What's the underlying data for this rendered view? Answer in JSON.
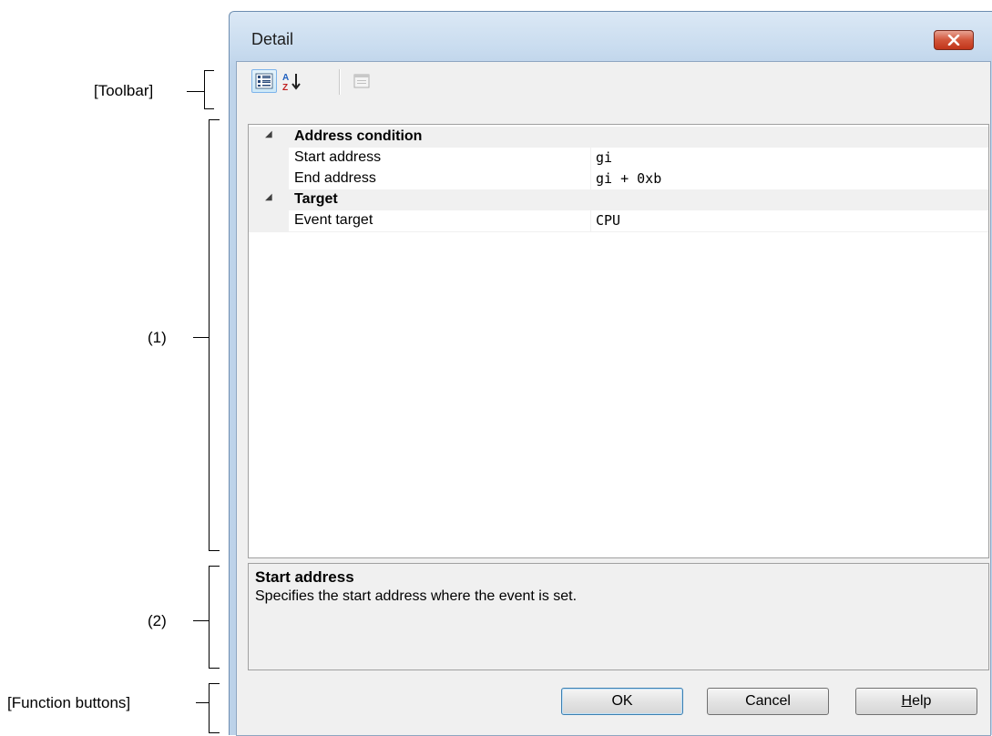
{
  "annotations": {
    "toolbar": "[Toolbar]",
    "area1": "(1)",
    "area2": "(2)",
    "function_buttons": "[Function buttons]"
  },
  "window": {
    "title": "Detail"
  },
  "toolbar": {
    "buttons": [
      {
        "icon": "categorized-view-icon",
        "active": true
      },
      {
        "icon": "sort-alphabetical-icon",
        "active": false
      },
      {
        "icon": "property-pages-icon",
        "active": false,
        "disabled": true
      }
    ]
  },
  "grid": {
    "categories": [
      {
        "label": "Address condition",
        "properties": [
          {
            "name": "Start address",
            "value": "gi"
          },
          {
            "name": "End address",
            "value": "gi + 0xb"
          }
        ]
      },
      {
        "label": "Target",
        "properties": [
          {
            "name": "Event target",
            "value": "CPU"
          }
        ]
      }
    ]
  },
  "description": {
    "title": "Start address",
    "text": "Specifies the start address where the event is set."
  },
  "buttons": {
    "ok": "OK",
    "cancel": "Cancel",
    "help_mnemonic": "H",
    "help_rest": "elp"
  },
  "colors": {
    "close_button": "#c1351a",
    "selection_border": "#7eb4ea"
  }
}
